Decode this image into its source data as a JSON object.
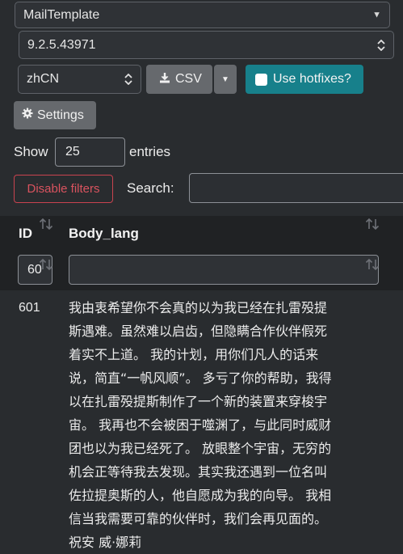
{
  "selects": {
    "template": "MailTemplate",
    "version": "9.2.5.43971",
    "language": "zhCN"
  },
  "buttons": {
    "csv": "CSV",
    "hotfixes": "Use hotfixes?",
    "settings": "Settings",
    "disable_filters": "Disable filters"
  },
  "length": {
    "show_label": "Show",
    "value": "25",
    "entries_label": "entries"
  },
  "search": {
    "label": "Search:",
    "value": ""
  },
  "table": {
    "columns": [
      "ID",
      "Body_lang"
    ],
    "filter_id_value": "60",
    "rows": [
      {
        "id": "601",
        "body_lines": [
          "我由衷希望你不会真的以为我已经在扎雷殁提",
          "斯遇难。虽然难以启齿，但隐瞒合作伙伴假死",
          "着实不上道。 我的计划，用你们凡人的话来",
          "说，简直“一帆风顺”。 多亏了你的帮助，我得",
          "以在扎雷殁提斯制作了一个新的装置来穿梭宇",
          "宙。 我再也不会被困于噬渊了，与此同时威财",
          "团也以为我已经死了。 放眼整个宇宙，无穷的",
          "机会正等待我去发现。其实我还遇到一位名叫",
          "佐拉提奥斯的人，他自愿成为我的向导。 我相",
          "信当我需要可靠的伙伴时，我们会再见面的。",
          "祝安 威·娜莉"
        ]
      }
    ]
  },
  "colors": {
    "background": "#292c2f",
    "header_bg": "#202224",
    "teal": "#17808b",
    "gray_button": "#66696d",
    "danger": "#d9535f"
  }
}
